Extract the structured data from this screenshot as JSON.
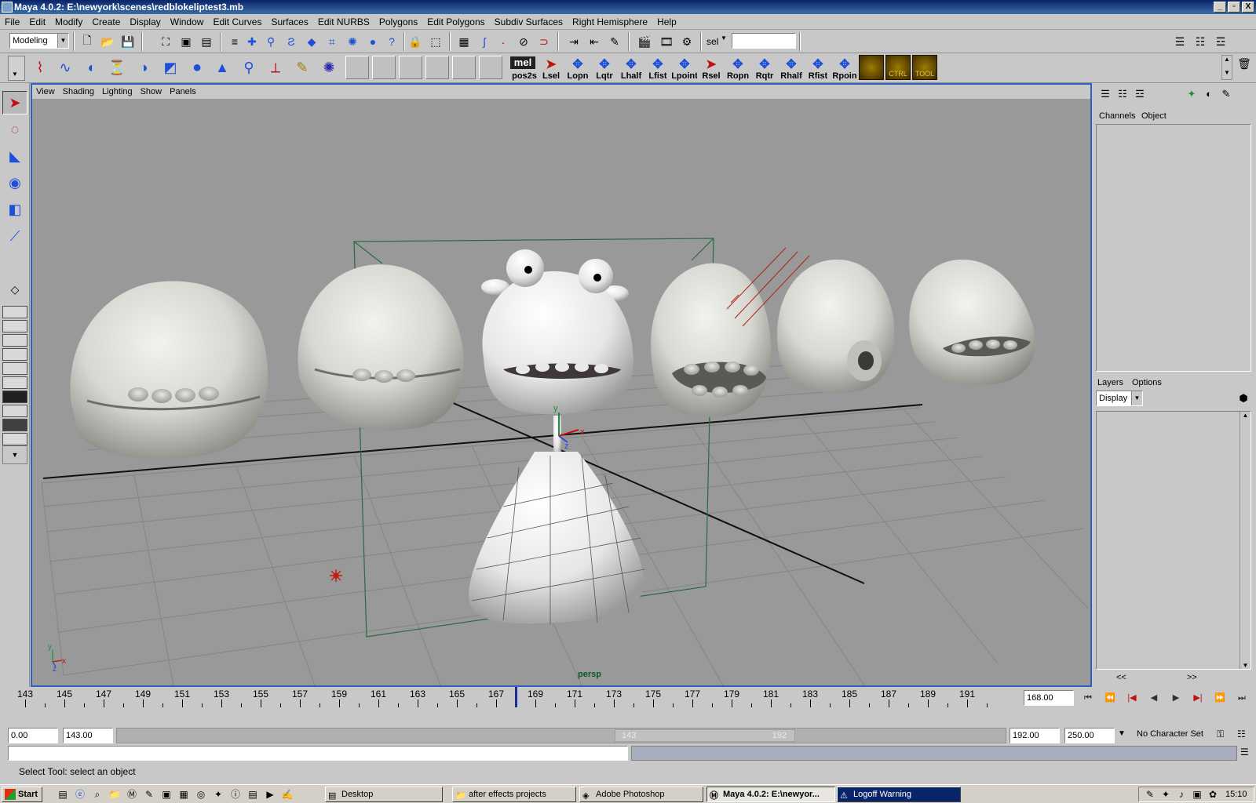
{
  "window": {
    "title": "Maya 4.0.2: E:\\newyork\\scenes\\redblokeliptest3.mb",
    "controls": [
      "_",
      "▫",
      "X"
    ]
  },
  "menubar": [
    "File",
    "Edit",
    "Modify",
    "Create",
    "Display",
    "Window",
    "Edit Curves",
    "Surfaces",
    "Edit NURBS",
    "Polygons",
    "Edit Polygons",
    "Subdiv Surfaces",
    "Right Hemisphere",
    "Help"
  ],
  "statusline": {
    "mode": "Modeling",
    "sel_label": "sel",
    "sel_value": ""
  },
  "shelf": {
    "mel_label": "mel",
    "buttons": [
      "pos2s",
      "Lsel",
      "Lopn",
      "Lqtr",
      "Lhalf",
      "Lfist",
      "Lpoint",
      "Rsel",
      "Ropn",
      "Rqtr",
      "Rhalf",
      "Rfist",
      "Rpoin"
    ],
    "gold": [
      "",
      "CTRL",
      "TOOL"
    ]
  },
  "viewport": {
    "menu": [
      "View",
      "Shading",
      "Lighting",
      "Show",
      "Panels"
    ],
    "camera": "persp",
    "axis": {
      "x": "x",
      "y": "y",
      "z": "z"
    }
  },
  "channelbox": {
    "tabs": [
      "Channels",
      "Object"
    ],
    "layers_tabs": [
      "Layers",
      "Options"
    ],
    "layer_mode": "Display",
    "scroll_left": "<<",
    "scroll_right": ">>"
  },
  "timeslider": {
    "ticks": [
      "143",
      "145",
      "147",
      "149",
      "151",
      "153",
      "155",
      "157",
      "159",
      "161",
      "163",
      "165",
      "167",
      "169",
      "171",
      "173",
      "175",
      "177",
      "179",
      "181",
      "183",
      "185",
      "187",
      "189",
      "191"
    ],
    "current_frame": "168.00",
    "current_value": 168
  },
  "range": {
    "anim_start": "0.00",
    "play_start": "143.00",
    "slider_start": "143",
    "slider_end": "192",
    "play_end": "192.00",
    "anim_end": "250.00",
    "character_set": "No Character Set"
  },
  "helpline": {
    "text": "Select Tool: select an object"
  },
  "taskbar": {
    "start": "Start",
    "tasks": [
      "Desktop",
      "after effects projects",
      "Adobe Photoshop",
      "Maya 4.0.2: E:\\newyor...",
      "Logoff Warning"
    ],
    "clock": "15:10"
  },
  "colors": {
    "title_gradient_start": "#0a246a",
    "viewport_bg": "#999999",
    "viewport_border": "#3060c0",
    "camera_label": "#0b5a2a",
    "bounding_box": "#2a6a40"
  }
}
